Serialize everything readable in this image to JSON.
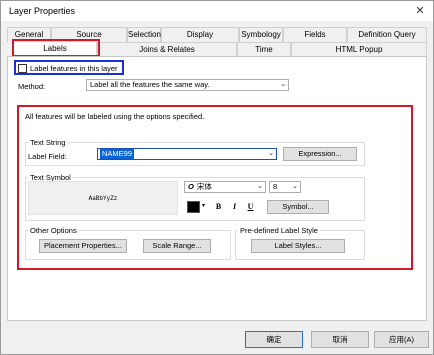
{
  "window": {
    "title": "Layer Properties"
  },
  "tabs_row1": [
    "General",
    "Source",
    "Selection",
    "Display",
    "Symbology",
    "Fields",
    "Definition Query"
  ],
  "tabs_row2": [
    "Labels",
    "Joins & Relates",
    "Time",
    "HTML Popup"
  ],
  "label_checkbox": {
    "label": "Label features in this layer",
    "checked": false
  },
  "method": {
    "label": "Method:",
    "value": "Label all the features the same way."
  },
  "info_text": "All features will be labeled using the options specified.",
  "text_string": {
    "group_title": "Text String",
    "field_label": "Label Field:",
    "field_value": "NAME99",
    "expression_button": "Expression..."
  },
  "text_symbol": {
    "group_title": "Text Symbol",
    "preview_text": "AaBbYyZz",
    "font_icon_glyph": "O",
    "font_name": "宋体",
    "font_size": "8",
    "color": "#000000",
    "bold": "B",
    "italic": "I",
    "underline": "U",
    "symbol_button": "Symbol..."
  },
  "other_options": {
    "group_title": "Other Options",
    "placement_button": "Placement Properties...",
    "scale_button": "Scale Range..."
  },
  "predefined": {
    "group_title": "Pre-defined Label Style",
    "styles_button": "Label Styles..."
  },
  "footer": {
    "ok": "确定",
    "cancel": "取消",
    "apply": "应用(A)"
  },
  "colors": {
    "highlight_red": "#d3182b",
    "highlight_blue": "#1c2fd0",
    "selection_blue": "#0a64d6"
  }
}
